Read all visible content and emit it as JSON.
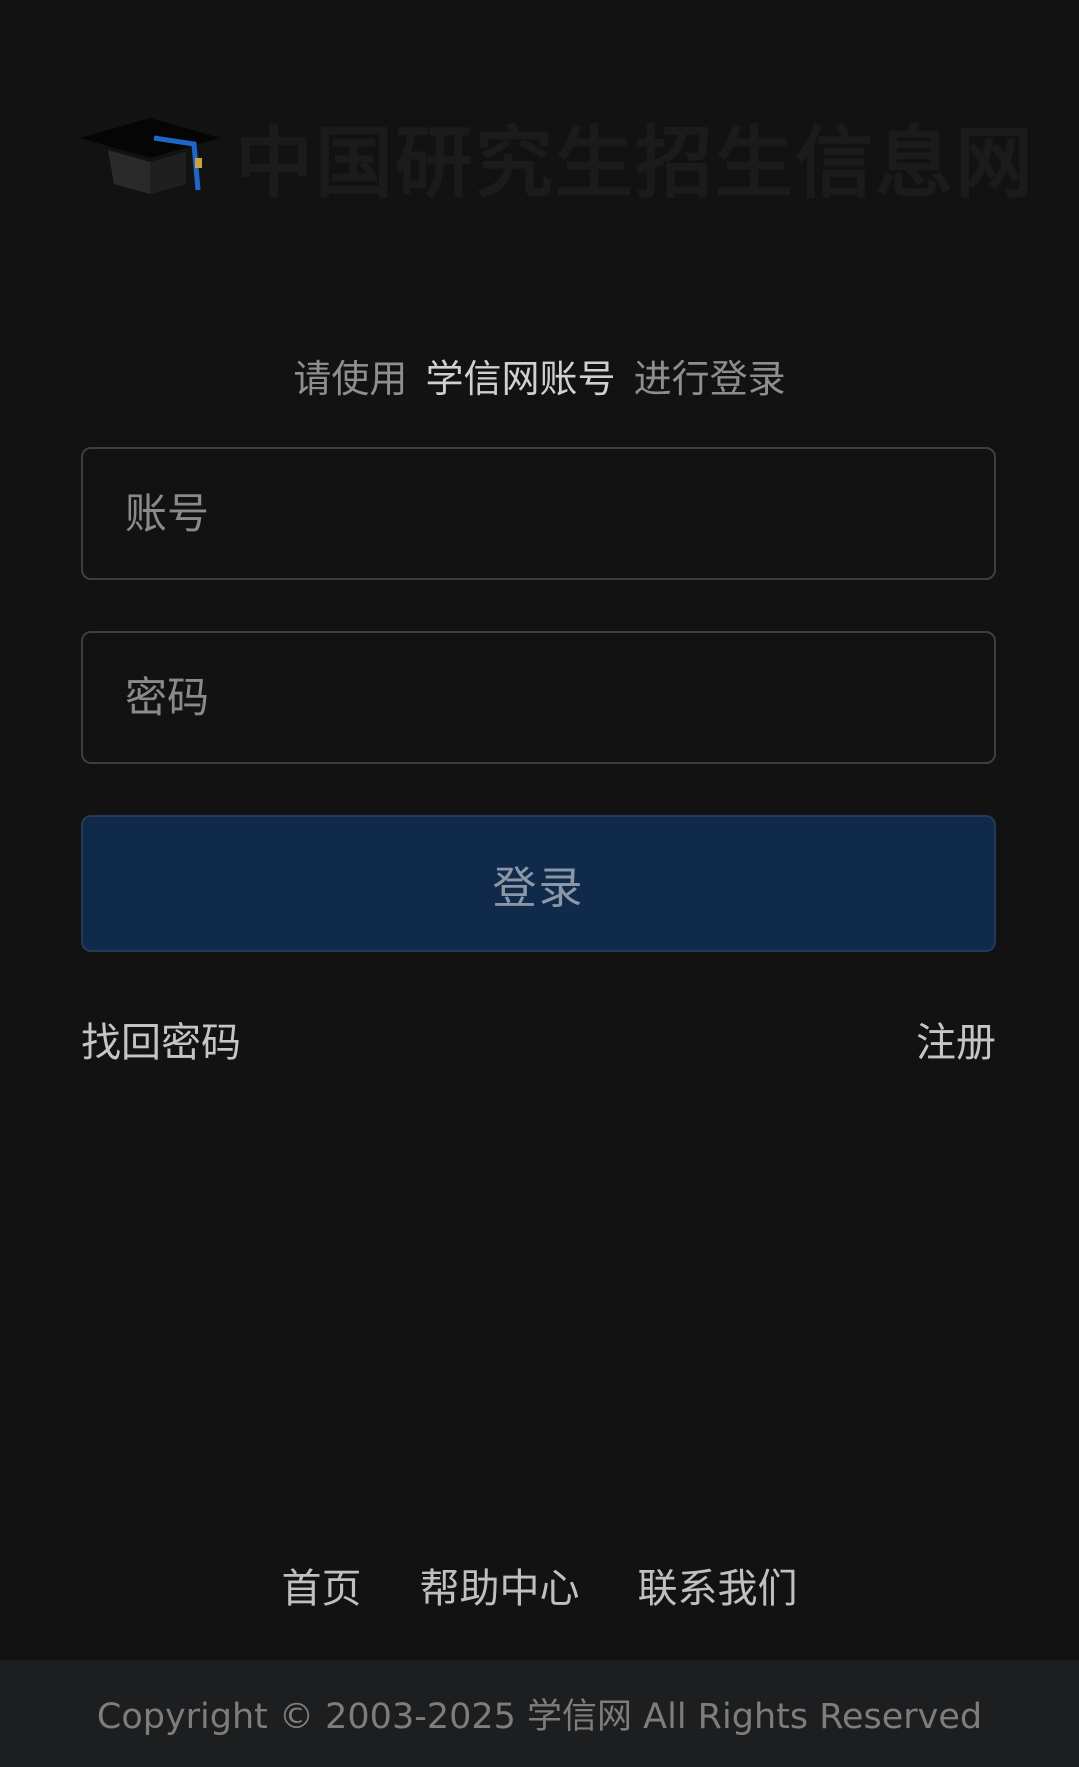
{
  "header": {
    "logo_text": "中国研究生招生信息网"
  },
  "login": {
    "prompt_prefix": "请使用",
    "prompt_account_type": "学信网账号",
    "prompt_suffix": "进行登录",
    "account_placeholder": "账号",
    "account_value": "",
    "password_placeholder": "密码",
    "password_value": "",
    "login_button": "登录",
    "forgot_password": "找回密码",
    "register": "注册"
  },
  "footer": {
    "links": [
      "首页",
      "帮助中心",
      "联系我们"
    ],
    "copyright": "Copyright © 2003-2025  学信网  All Rights Reserved"
  },
  "colors": {
    "background": "#121212",
    "button_bg": "#0f2a4a",
    "input_border": "#3b3f45",
    "footer_bar": "#1d1e20",
    "logo_accent": "#1e66c8"
  },
  "icons": {
    "logo": "graduation-cap-icon"
  }
}
